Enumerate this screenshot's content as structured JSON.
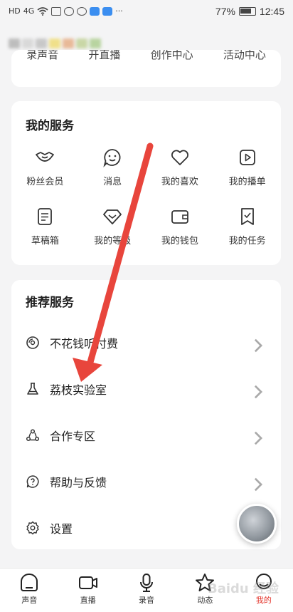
{
  "status_bar": {
    "left_glyphs": [
      "HD",
      "4G"
    ],
    "battery": "77%",
    "time": "12:45",
    "more": "···"
  },
  "colors": {
    "accent_red": "#e3332a",
    "background": "#f4f4f5",
    "card": "#ffffff",
    "arrow": "#e8453c"
  },
  "top_card": {
    "clipped_labels": [
      "录声音",
      "开直播",
      "创作中心",
      "活动中心"
    ]
  },
  "my_services": {
    "title": "我的服务",
    "items": [
      {
        "label": "粉丝会员",
        "icon": "fan-member-icon"
      },
      {
        "label": "消息",
        "icon": "message-icon"
      },
      {
        "label": "我的喜欢",
        "icon": "heart-icon"
      },
      {
        "label": "我的播单",
        "icon": "playlist-icon"
      },
      {
        "label": "草稿箱",
        "icon": "draft-icon"
      },
      {
        "label": "我的等级",
        "icon": "level-icon"
      },
      {
        "label": "我的钱包",
        "icon": "wallet-icon"
      },
      {
        "label": "我的任务",
        "icon": "task-icon"
      }
    ]
  },
  "recommend": {
    "title": "推荐服务",
    "items": [
      {
        "label": "不花钱听付费",
        "icon": "disc-icon"
      },
      {
        "label": "荔枝实验室",
        "icon": "flask-icon"
      },
      {
        "label": "合作专区",
        "icon": "cooperation-icon"
      },
      {
        "label": "帮助与反馈",
        "icon": "help-icon"
      },
      {
        "label": "设置",
        "icon": "settings-icon"
      }
    ]
  },
  "bottom_nav": {
    "items": [
      {
        "label": "声音",
        "icon": "sound-icon"
      },
      {
        "label": "直播",
        "icon": "live-icon"
      },
      {
        "label": "录音",
        "icon": "microphone-icon"
      },
      {
        "label": "动态",
        "icon": "star-icon"
      },
      {
        "label": "我的",
        "icon": "profile-icon",
        "active": true
      }
    ]
  },
  "watermark": "Baidu 经验"
}
